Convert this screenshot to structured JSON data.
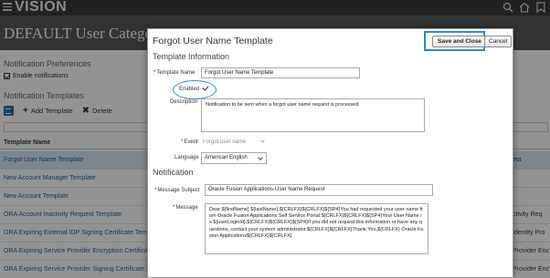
{
  "app": {
    "brand": "VISION"
  },
  "page": {
    "title": "DEFAULT User Category",
    "notification_preferences": {
      "heading": "Notification Preferences",
      "enable_label": "Enable notifications",
      "enabled": true
    },
    "templates": {
      "heading": "Notification Templates",
      "add_label": "Add Template",
      "delete_label": "Delete",
      "column_header": "Template Name",
      "rows": [
        {
          "name": "Forgot User Name Template",
          "right": ""
        },
        {
          "name": "New Account Manager Template",
          "right": ""
        },
        {
          "name": "New Account Template",
          "right": ""
        },
        {
          "name": "ORA Account Inactivity Request Template",
          "right": "ctivity Req"
        },
        {
          "name": "ORA Expiring External IDP Signing Certificate Template",
          "right": "Identity Pro"
        },
        {
          "name": "ORA Expiring Service Provider Encryption Certificate Template",
          "right": "Provider Enc"
        },
        {
          "name": "ORA Expiring Service Provider Signing Certificate Template",
          "right": "Provider Enc"
        }
      ],
      "selected_row_right": "est"
    }
  },
  "dialog": {
    "title": "Forgot User Name Template",
    "save_close_label": "Save and Close",
    "cancel_label": "Cancel",
    "template_info_heading": "Template Information",
    "template_name_label": "Template Name",
    "template_name_value": "Forgot User Name Template",
    "enabled_label": "Enabled",
    "enabled": true,
    "description_label": "Description",
    "description_value": "Notification to be sent when a forgot user name request is processed",
    "event_label": "Event",
    "event_value": "Forgot user name",
    "language_label": "Language",
    "language_value": "American English",
    "notification_heading": "Notification",
    "message_subject_label": "Message Subject",
    "message_subject_value": "Oracle Fusion Applications-User Name Request",
    "message_label": "Message",
    "message_value": "Dear ${firstName} ${lastName},${CRLFX}${CRLFX}${SP4}You had requested your user name from Oracle Fusion Applications Self Service Portal.${CRLFX}${CRLFX}${SP4}Your User Name is ${userLoginId}.${CRLFX}${CRLFX}${SP4}If you did not request this information or have any questions, contact your system administrator.${CRLFX}${CRLFX}Thank You,${CRLFX} Oracle Fusion Applications${CRLFX}${CRLFX}"
  },
  "colors": {
    "accent_ring": "#2d8ad2",
    "link": "#1f5f9c",
    "topbar": "#3a3a3a"
  },
  "icons": [
    "menu-icon",
    "search-icon",
    "home-icon",
    "favorites-icon",
    "list-icon",
    "add-icon",
    "delete-icon",
    "check-icon"
  ]
}
